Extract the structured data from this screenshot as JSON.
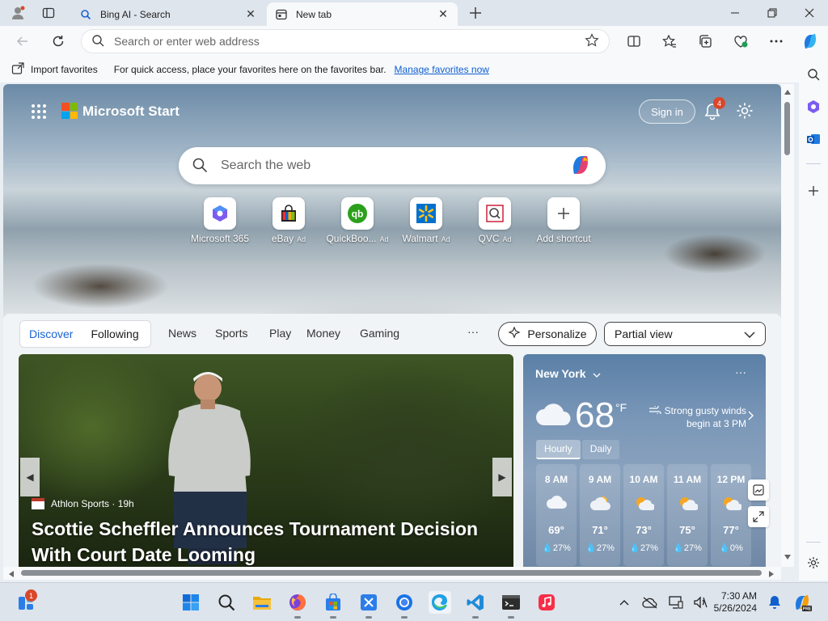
{
  "tabs": [
    {
      "title": "Bing AI - Search",
      "active": false
    },
    {
      "title": "New tab",
      "active": true
    }
  ],
  "address": {
    "placeholder": "Search or enter web address"
  },
  "favorites_bar": {
    "import_label": "Import favorites",
    "message": "For quick access, place your favorites here on the favorites bar.",
    "manage_link": "Manage favorites now"
  },
  "start": {
    "brand": "Microsoft Start",
    "sign_in": "Sign in",
    "notification_count": "4",
    "search_placeholder": "Search the web",
    "shortcuts": [
      {
        "label": "Microsoft 365",
        "ad": ""
      },
      {
        "label": "eBay",
        "ad": "Ad"
      },
      {
        "label": "QuickBoo...",
        "ad": "Ad"
      },
      {
        "label": "Walmart",
        "ad": "Ad"
      },
      {
        "label": "QVC",
        "ad": "Ad"
      },
      {
        "label": "Add shortcut",
        "ad": ""
      }
    ]
  },
  "feed": {
    "segment": [
      "Discover",
      "Following"
    ],
    "links": [
      "News",
      "Sports",
      "Play",
      "Money",
      "Gaming"
    ],
    "more": "···",
    "personalize": "Personalize",
    "view": "Partial view"
  },
  "story": {
    "source": "Athlon Sports · 19h",
    "headline": "Scottie Scheffler Announces Tournament Decision With Court Date Looming"
  },
  "weather": {
    "city": "New York",
    "temp": "68",
    "unit": "°F",
    "alert": "Strong gusty winds begin at 3 PM",
    "tabs": [
      "Hourly",
      "Daily"
    ],
    "hours": [
      {
        "time": "8 AM",
        "temp": "69°",
        "precip": "27%",
        "icon": "cloud-icon"
      },
      {
        "time": "9 AM",
        "temp": "71°",
        "precip": "27%",
        "icon": "partly-cloudy-icon"
      },
      {
        "time": "10 AM",
        "temp": "73°",
        "precip": "27%",
        "icon": "sun-cloud-icon"
      },
      {
        "time": "11 AM",
        "temp": "75°",
        "precip": "27%",
        "icon": "sun-cloud-icon"
      },
      {
        "time": "12 PM",
        "temp": "77°",
        "precip": "0%",
        "icon": "sun-cloud-icon"
      }
    ]
  },
  "taskbar": {
    "widget_badge": "1",
    "time": "7:30 AM",
    "date": "5/26/2024"
  },
  "colors": {
    "accent": "#1a63d1",
    "badge": "#d9472b",
    "link": "#0f5fcf"
  }
}
